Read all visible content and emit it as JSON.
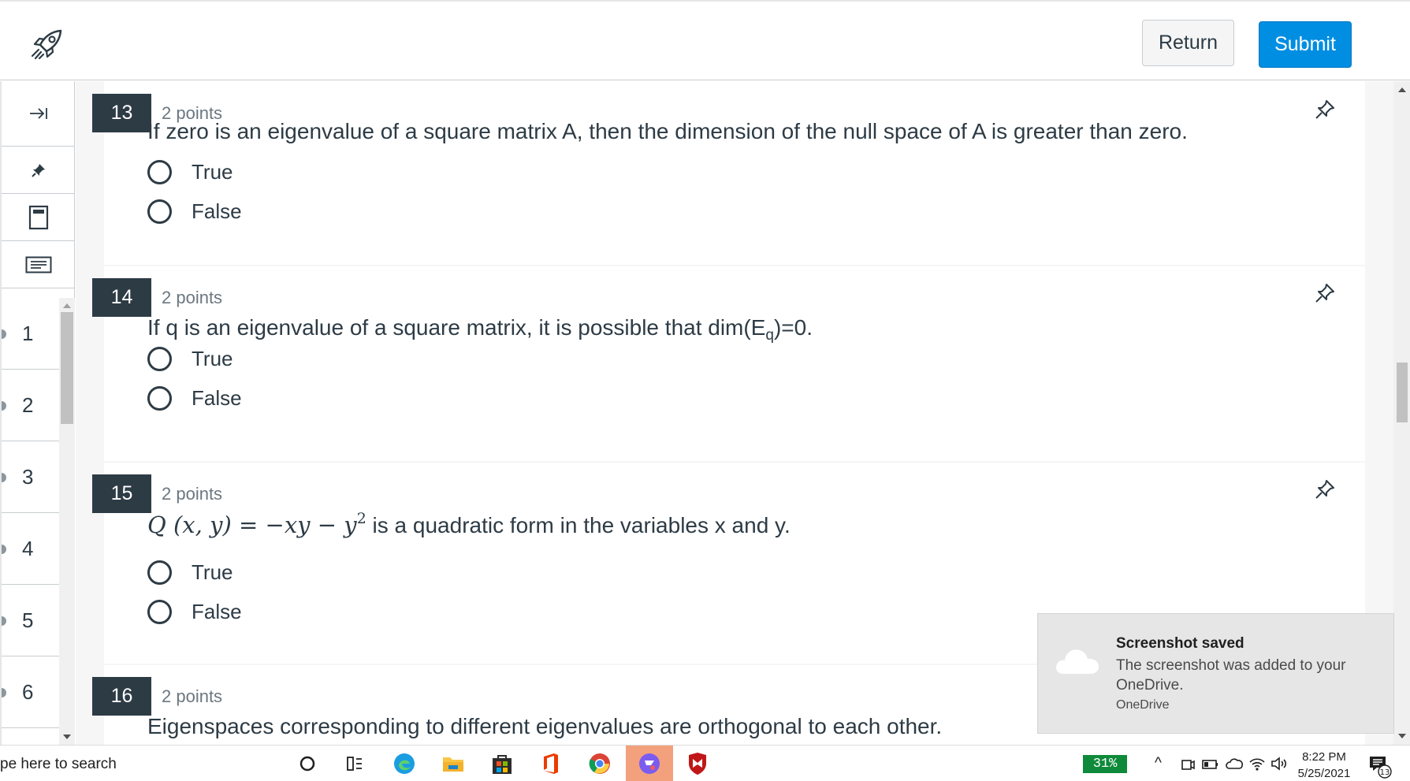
{
  "header": {
    "logo_icon": "rocket-icon",
    "return_label": "Return",
    "submit_label": "Submit",
    "submit_color": "#008ee2"
  },
  "sidebar": {
    "tools": [
      {
        "icon": "collapse-arrow-icon"
      },
      {
        "icon": "pin-icon"
      },
      {
        "icon": "calculator-icon"
      },
      {
        "icon": "notes-icon"
      }
    ],
    "questions": [
      "1",
      "2",
      "3",
      "4",
      "5",
      "6"
    ]
  },
  "questions": [
    {
      "number": "13",
      "points": "2 points",
      "text": "If zero is an eigenvalue of a square matrix A, then the dimension of the null space of A is greater than zero.",
      "options": [
        "True",
        "False"
      ]
    },
    {
      "number": "14",
      "points": "2 points",
      "text_before": "If q is an eigenvalue of a square matrix, it is possible that dim(E",
      "text_sub": "q",
      "text_after": ")=0.",
      "options": [
        "True",
        "False"
      ]
    },
    {
      "number": "15",
      "points": "2 points",
      "math": "Q (x, y) = −xy − y",
      "math_sup": "2",
      "text_after": " is a quadratic form in the variables x and y.",
      "options": [
        "True",
        "False"
      ]
    },
    {
      "number": "16",
      "points": "2 points",
      "text": "Eigenspaces corresponding to different eigenvalues are orthogonal to each other."
    }
  ],
  "toast": {
    "title": "Screenshot saved",
    "body": "The screenshot was added to your OneDrive.",
    "app": "OneDrive"
  },
  "taskbar": {
    "search_placeholder": "pe here to search",
    "battery": "31%",
    "time": "8:22 PM",
    "date": "5/25/2021",
    "notification_count": "13"
  }
}
